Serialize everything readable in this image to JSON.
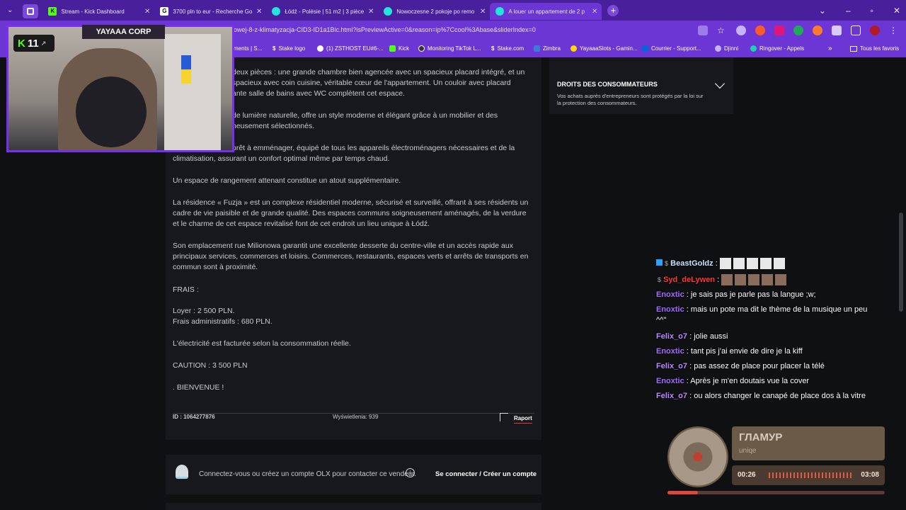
{
  "browser": {
    "tabs": [
      {
        "title": "Stream - Kick Dashboard",
        "fav": "K",
        "fav_color": "#53fc18"
      },
      {
        "title": "3700 pln to eur - Recherche Go",
        "fav": "G",
        "fav_color": "#ffffff"
      },
      {
        "title": "Łódź - Polésie | 51 m2 | 3 pièce",
        "fav": "olx",
        "fav_color": "#23e5db"
      },
      {
        "title": "Nowoczesne 2 pokoje po remo",
        "fav": "olx",
        "fav_color": "#23e5db"
      },
      {
        "title": "A louer un appartement de 2 p",
        "fav": "olx",
        "fav_color": "#23e5db"
      }
    ],
    "url": "owej-8-z-klimatyzacja-CID3-ID1a1Bic.html?isPreviewActive=0&reason=ip%7Ccool%3Abase&sliderIndex=0",
    "bookmarks": [
      {
        "label": "ments | S..."
      },
      {
        "label": "Stake logo"
      },
      {
        "label": "(1) ZSTHOST EU#6-..."
      },
      {
        "label": "Kick"
      },
      {
        "label": "Monitoring TikTok L..."
      },
      {
        "label": "Stake.com"
      },
      {
        "label": "Zimbra"
      },
      {
        "label": "YayaaaSlots - Gamin..."
      },
      {
        "label": "Courrier - Support..."
      },
      {
        "label": "Djinni"
      },
      {
        "label": "Ringover - Appels"
      },
      {
        "label": "Tous les favoris"
      }
    ]
  },
  "listing": {
    "paragraphs": [
      "deux pièces : une grande chambre bien agencée avec un spacieux placard intégré, et un",
      "spacieux avec coin cuisine, véritable cœur de l'appartement. Un couloir avec placard",
      "ante salle de bains avec WC complètent cet espace.",
      "de lumière naturelle, offre un style moderne et élégant grâce à un mobilier et des",
      "neusement sélectionnés.",
      "prêt à emménager, équipé de tous les appareils électroménagers nécessaires et de la",
      "climatisation, assurant un confort optimal même par temps chaud.",
      "Un espace de rangement attenant constitue un atout supplémentaire.",
      "La résidence « Fuzja » est un complexe résidentiel moderne, sécurisé et surveillé, offrant à ses résidents un",
      "cadre de vie paisible et de grande qualité. Des espaces communs soigneusement aménagés, de la verdure",
      "et le charme de cet espace revitalisé font de cet endroit un lieu unique à Łódź.",
      "Son emplacement rue Milionowa garantit une excellente desserte du centre-ville et un accès rapide aux",
      "principaux services, commerces et loisirs. Commerces, restaurants, espaces verts et arrêts de transports en",
      "commun sont à proximité.",
      "FRAIS :",
      "Loyer : 2 500 PLN.",
      "Frais administratifs : 680 PLN.",
      "L'électricité est facturée selon la consommation réelle.",
      "CAUTION : 3 500 PLN",
      ". BIENVENUE !"
    ],
    "id_label": "ID : 1064277876",
    "views_label": "Wyświetlenia: 939",
    "report_label": "Raport",
    "contact_text": "Connectez-vous ou créez un compte OLX pour contacter ce vendeur.",
    "login_label": "Se connecter / Créer un compte"
  },
  "sidebar": {
    "consumer_title": "DROITS DES CONSOMMATEURS",
    "consumer_text_1": "Vos achats auprès d'entrepreneurs sont protégés par la loi sur",
    "consumer_text_2": "la protection des consommateurs."
  },
  "stream": {
    "channel_label": "YAYAAA CORP",
    "viewer_count": "11",
    "kick_badge": "K",
    "chat": [
      {
        "user": "BeastGoldz",
        "color": "#c9e5ff",
        "text": ""
      },
      {
        "user": "Syd_deLywen",
        "color": "#ff3a3a",
        "text": ""
      },
      {
        "user": "Enoxtic",
        "color": "#9b5cff",
        "text": " : je sais pas je parle pas la langue ;w;"
      },
      {
        "user": "Enoxtic",
        "color": "#9b5cff",
        "text": " : mais un pote ma dit le thème de la musique un peu"
      },
      {
        "user": "",
        "color": "#ffffff",
        "text": "^^\""
      },
      {
        "user": "Felix_o7",
        "color": "#ad7cff",
        "text": " : jolie aussi"
      },
      {
        "user": "Enoxtic",
        "color": "#9b5cff",
        "text": " : tant pis j'ai envie de dire je la kiff"
      },
      {
        "user": "Felix_o7",
        "color": "#ad7cff",
        "text": " : pas assez de place pour placer la télé"
      },
      {
        "user": "Enoxtic",
        "color": "#9b5cff",
        "text": " : Après je m'en doutais vue la cover"
      },
      {
        "user": "Felix_o7",
        "color": "#ad7cff",
        "text": " : ou alors changer le canapé de place dos à la vitre"
      }
    ],
    "music": {
      "title": "ГЛАМУР",
      "artist": "uniqe",
      "elapsed": "00:26",
      "duration": "03:08",
      "progress": 0.14
    }
  }
}
